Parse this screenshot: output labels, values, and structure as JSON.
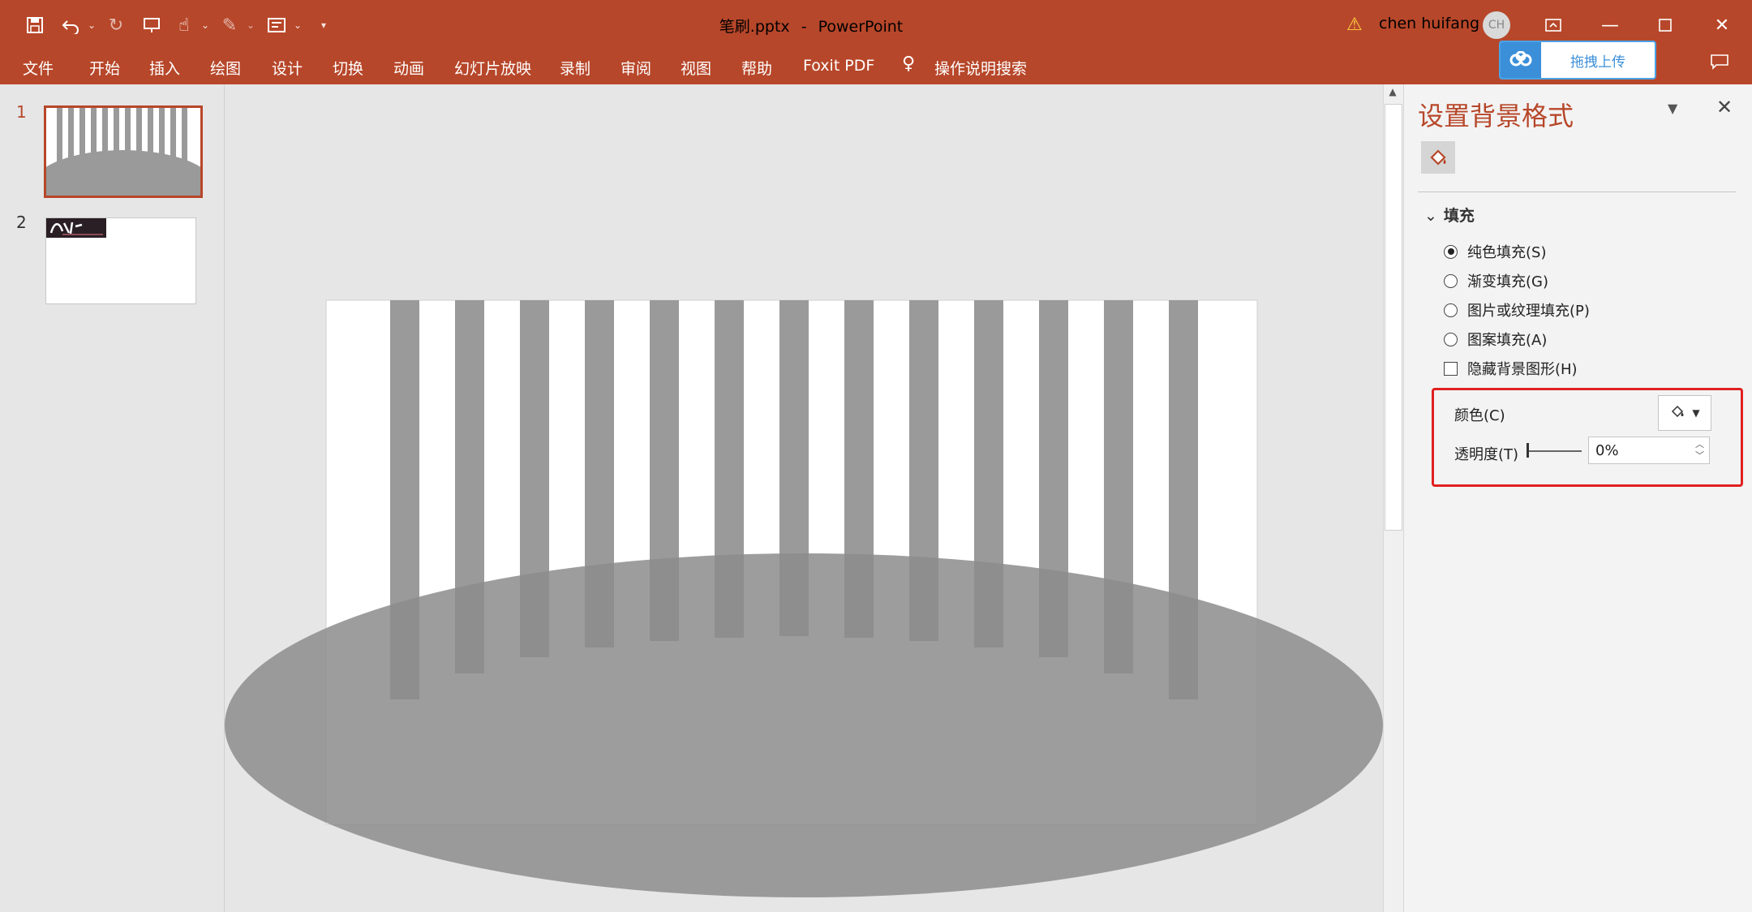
{
  "window": {
    "doc_name": "笔刷.pptx",
    "separator": "-",
    "app_name": "PowerPoint",
    "user_name": "chen huifang",
    "user_initials": "CH",
    "accent_color": "#b7472a"
  },
  "quick_access": {
    "icons": [
      "save-icon",
      "undo-icon",
      "redo-icon",
      "present-icon",
      "touch-mode-icon",
      "pen-icon",
      "slide-layout-icon",
      "customize-icon"
    ]
  },
  "ribbon": {
    "tabs": [
      "文件",
      "开始",
      "插入",
      "绘图",
      "设计",
      "切换",
      "动画",
      "幻灯片放映",
      "录制",
      "审阅",
      "视图",
      "帮助",
      "Foxit PDF",
      "操作说明搜索"
    ]
  },
  "upload": {
    "label": "拖拽上传"
  },
  "thumbnails": {
    "slide1_number": "1",
    "slide2_number": "2"
  },
  "format_pane": {
    "title": "设置背景格式",
    "section_fill": "填充",
    "options": [
      {
        "label": "纯色填充(S)",
        "selected": true
      },
      {
        "label": "渐变填充(G)",
        "selected": false
      },
      {
        "label": "图片或纹理填充(P)",
        "selected": false
      },
      {
        "label": "图案填充(A)",
        "selected": false
      }
    ],
    "hide_background_graphics": {
      "label": "隐藏背景图形(H)",
      "checked": false
    },
    "color_label": "颜色(C)",
    "transparency_label": "透明度(T)",
    "transparency_value": "0%"
  },
  "slide": {
    "stripe_color": "#9a9a9a",
    "ellipse_color": "#8c8c8c"
  }
}
